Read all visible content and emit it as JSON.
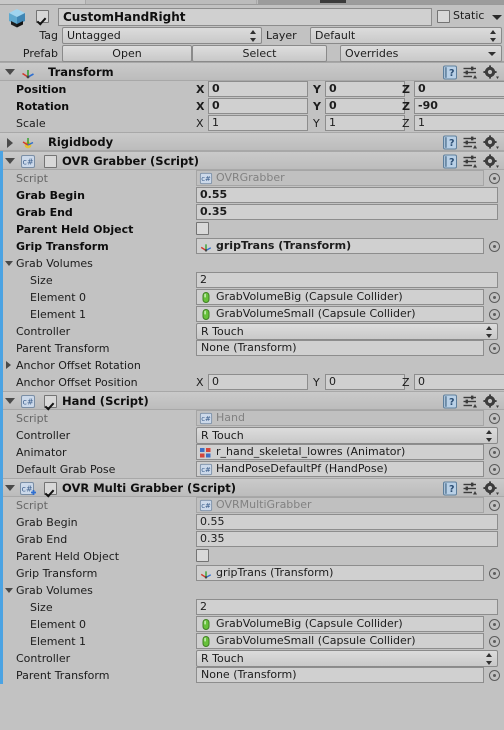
{
  "window": {
    "title": "Inspector",
    "background_color": "#c2c2c2",
    "override_bar_color": "#4ba3e3"
  },
  "gameobject_header": {
    "icon": "prefab-cube-icon",
    "enabled": true,
    "name": "CustomHandRight",
    "static_label": "Static",
    "static_checked": false,
    "tag_label": "Tag",
    "tag_value": "Untagged",
    "layer_label": "Layer",
    "layer_value": "Default",
    "prefab_label": "Prefab",
    "open_button": "Open",
    "select_button": "Select",
    "overrides_button": "Overrides"
  },
  "components": [
    {
      "name": "Transform",
      "icon": "transform-icon",
      "expanded": true,
      "has_checkbox": false,
      "rows": [
        {
          "type": "vector3",
          "label": "Position",
          "bold": true,
          "x": "0",
          "y": "0",
          "z": "0"
        },
        {
          "type": "vector3",
          "label": "Rotation",
          "bold": true,
          "x": "0",
          "y": "0",
          "z": "-90"
        },
        {
          "type": "vector3",
          "label": "Scale",
          "bold": false,
          "x": "1",
          "y": "1",
          "z": "1"
        }
      ]
    },
    {
      "name": "Rigidbody",
      "icon": "rigidbody-icon",
      "expanded": false,
      "has_checkbox": false,
      "rows": []
    },
    {
      "name": "OVR Grabber (Script)",
      "icon": "cs-script-icon",
      "expanded": true,
      "has_checkbox": true,
      "checked": false,
      "rows": [
        {
          "type": "object",
          "label": "Script",
          "value": "OVRGrabber",
          "icon": "cs-script-icon",
          "disabled": true,
          "bold": false,
          "indent": 0
        },
        {
          "type": "text",
          "label": "Grab Begin",
          "value": "0.55",
          "bold": true,
          "indent": 0
        },
        {
          "type": "text",
          "label": "Grab End",
          "value": "0.35",
          "bold": true,
          "indent": 0
        },
        {
          "type": "checkbox",
          "label": "Parent Held Object",
          "checked": false,
          "bold": true,
          "indent": 0
        },
        {
          "type": "object",
          "label": "Grip Transform",
          "value": "gripTrans (Transform)",
          "icon": "transform-icon",
          "bold": true,
          "indent": 0
        },
        {
          "type": "foldout",
          "label": "Grab Volumes",
          "expanded": true,
          "bold": false,
          "indent": 0
        },
        {
          "type": "text",
          "label": "Size",
          "value": "2",
          "bold": false,
          "indent": 1
        },
        {
          "type": "object",
          "label": "Element 0",
          "value": "GrabVolumeBig (Capsule Collider)",
          "icon": "capsule-collider-icon",
          "bold": false,
          "indent": 1
        },
        {
          "type": "object",
          "label": "Element 1",
          "value": "GrabVolumeSmall (Capsule Collider)",
          "icon": "capsule-collider-icon",
          "bold": false,
          "indent": 1
        },
        {
          "type": "popup",
          "label": "Controller",
          "value": "R Touch",
          "bold": false,
          "indent": 0
        },
        {
          "type": "object",
          "label": "Parent Transform",
          "value": "None (Transform)",
          "icon": "none-icon",
          "bold": false,
          "indent": 0
        },
        {
          "type": "foldout",
          "label": "Anchor Offset Rotation",
          "expanded": false,
          "bold": false,
          "indent": 0
        },
        {
          "type": "vector3",
          "label": "Anchor Offset Position",
          "bold": false,
          "x": "0",
          "y": "0",
          "z": "0",
          "indent": 0
        }
      ]
    },
    {
      "name": "Hand (Script)",
      "icon": "cs-script-icon",
      "expanded": true,
      "has_checkbox": true,
      "checked": true,
      "rows": [
        {
          "type": "object",
          "label": "Script",
          "value": "Hand",
          "icon": "cs-script-icon",
          "disabled": true,
          "bold": false,
          "indent": 0
        },
        {
          "type": "popup",
          "label": "Controller",
          "value": "R Touch",
          "bold": false,
          "indent": 0
        },
        {
          "type": "object",
          "label": "Animator",
          "value": "r_hand_skeletal_lowres (Animator)",
          "icon": "animator-icon",
          "bold": false,
          "indent": 0
        },
        {
          "type": "object",
          "label": "Default Grab Pose",
          "value": "HandPoseDefaultPf (HandPose)",
          "icon": "cs-script-icon",
          "bold": false,
          "indent": 0
        }
      ]
    },
    {
      "name": "OVR Multi Grabber (Script)",
      "icon": "cs-script-add-icon",
      "expanded": true,
      "has_checkbox": true,
      "checked": true,
      "rows": [
        {
          "type": "object",
          "label": "Script",
          "value": "OVRMultiGrabber",
          "icon": "cs-script-icon",
          "disabled": true,
          "bold": false,
          "indent": 0
        },
        {
          "type": "text",
          "label": "Grab Begin",
          "value": "0.55",
          "bold": false,
          "indent": 0
        },
        {
          "type": "text",
          "label": "Grab End",
          "value": "0.35",
          "bold": false,
          "indent": 0
        },
        {
          "type": "checkbox",
          "label": "Parent Held Object",
          "checked": false,
          "bold": false,
          "indent": 0
        },
        {
          "type": "object",
          "label": "Grip Transform",
          "value": "gripTrans (Transform)",
          "icon": "transform-icon",
          "bold": false,
          "indent": 0
        },
        {
          "type": "foldout",
          "label": "Grab Volumes",
          "expanded": true,
          "bold": false,
          "indent": 0
        },
        {
          "type": "text",
          "label": "Size",
          "value": "2",
          "bold": false,
          "indent": 1
        },
        {
          "type": "object",
          "label": "Element 0",
          "value": "GrabVolumeBig (Capsule Collider)",
          "icon": "capsule-collider-icon",
          "bold": false,
          "indent": 1
        },
        {
          "type": "object",
          "label": "Element 1",
          "value": "GrabVolumeSmall (Capsule Collider)",
          "icon": "capsule-collider-icon",
          "bold": false,
          "indent": 1
        },
        {
          "type": "popup",
          "label": "Controller",
          "value": "R Touch",
          "bold": false,
          "indent": 0
        },
        {
          "type": "object",
          "label": "Parent Transform",
          "value": "None (Transform)",
          "icon": "none-icon",
          "bold": false,
          "indent": 0
        }
      ]
    }
  ],
  "header_icons": [
    "help-icon",
    "preset-icon",
    "gear-icon"
  ],
  "axis_labels": [
    "X",
    "Y",
    "Z"
  ]
}
